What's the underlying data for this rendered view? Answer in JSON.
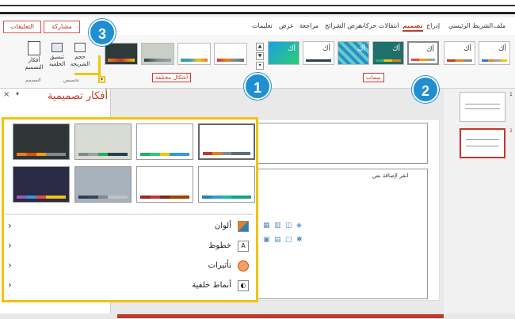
{
  "tabs": [
    {
      "label": "ملف"
    },
    {
      "label": "الشريط الرئيسي"
    },
    {
      "label": "إدراج"
    },
    {
      "label": "تصميم",
      "active": true
    },
    {
      "label": "انتقالات"
    },
    {
      "label": "حركات"
    },
    {
      "label": "عرض الشرائح"
    },
    {
      "label": "مراجعة"
    },
    {
      "label": "عرض"
    },
    {
      "label": "تعليمات"
    }
  ],
  "header": {
    "share": "مشاركة",
    "comments": "التعليقات"
  },
  "ribbon": {
    "themes_group": "سِمات",
    "variants_group": "أشكال مختلفة",
    "slide_size": "حجم الشريحة",
    "format_background": "تنسيق الخلفية",
    "designer": "أفكار التصميم",
    "customize_group": "تخصيص",
    "designer_group": "المصمم",
    "theme_sample": "أك"
  },
  "badges": {
    "one": "1",
    "two": "2",
    "three": "3"
  },
  "pane": {
    "title": "أفكار تصميمية",
    "close": "×",
    "pin": "▾"
  },
  "slide": {
    "content_placeholder": "انقر لإضافة نص"
  },
  "thumbnails": [
    {
      "num": "1"
    },
    {
      "num": "2"
    }
  ],
  "variants_menu": {
    "items": [
      {
        "label": "ألوان",
        "icon": "colors-icon"
      },
      {
        "label": "خطوط",
        "icon": "fonts-icon"
      },
      {
        "label": "تأثيرات",
        "icon": "effects-icon"
      },
      {
        "label": "أنماط خلفية",
        "icon": "background-styles-icon"
      }
    ],
    "chevron": "‹"
  },
  "colors": {
    "accent": "#c0392b",
    "highlight": "#f1c40f",
    "badge": "#1f8fd1"
  }
}
